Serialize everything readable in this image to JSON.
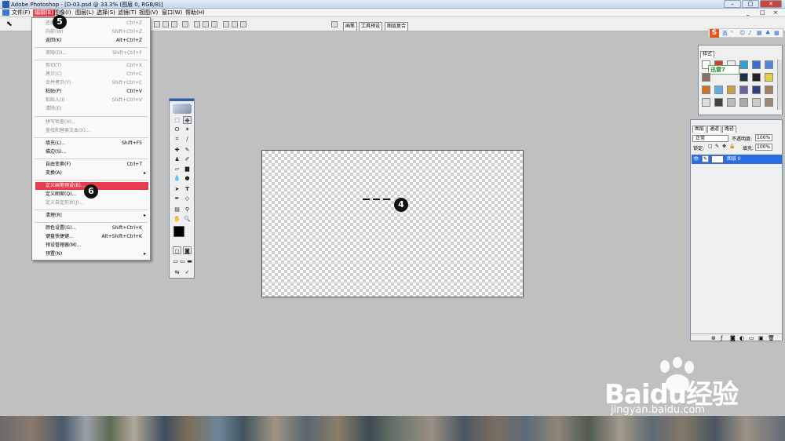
{
  "window": {
    "title": "Adobe Photoshop - [D-03.psd @ 33.3% (图层 0, RGB/8)]"
  },
  "menubar": [
    {
      "label": "文件(F)"
    },
    {
      "label": "编辑(E)",
      "active": true
    },
    {
      "label": "图像(I)"
    },
    {
      "label": "图层(L)"
    },
    {
      "label": "选择(S)"
    },
    {
      "label": "滤镜(T)"
    },
    {
      "label": "视图(V)"
    },
    {
      "label": "窗口(W)"
    },
    {
      "label": "帮助(H)"
    }
  ],
  "palette_well_tabs": [
    "画笔",
    "工具预设",
    "图层复合"
  ],
  "edit_menu": [
    {
      "label": "还原(O)",
      "shortcut": "Ctrl+Z",
      "disabled": true
    },
    {
      "label": "向前(W)",
      "shortcut": "Shift+Ctrl+Z",
      "disabled": true
    },
    {
      "label": "返回(K)",
      "shortcut": "Alt+Ctrl+Z"
    },
    {
      "label": "渐隐(D)...",
      "shortcut": "Shift+Ctrl+F",
      "disabled": true
    },
    {
      "label": "剪切(T)",
      "shortcut": "Ctrl+X",
      "disabled": true
    },
    {
      "label": "拷贝(C)",
      "shortcut": "Ctrl+C",
      "disabled": true
    },
    {
      "label": "合并拷贝(Y)",
      "shortcut": "Shift+Ctrl+C",
      "disabled": true
    },
    {
      "label": "粘贴(P)",
      "shortcut": "Ctrl+V"
    },
    {
      "label": "粘贴入(I)",
      "shortcut": "Shift+Ctrl+V",
      "disabled": true
    },
    {
      "label": "清除(E)",
      "disabled": true
    },
    {
      "label": "拼写检查(H)...",
      "disabled": true
    },
    {
      "label": "查找和替换文本(X)...",
      "disabled": true
    },
    {
      "label": "填充(L)...",
      "shortcut": "Shift+F5"
    },
    {
      "label": "描边(S)..."
    },
    {
      "label": "自由变换(F)",
      "shortcut": "Ctrl+T"
    },
    {
      "label": "变换(A)",
      "submenu": true
    },
    {
      "label": "定义画笔预设(B)...",
      "highlighted": true
    },
    {
      "label": "定义图案(Q)..."
    },
    {
      "label": "定义自定形状(J)...",
      "disabled": true
    },
    {
      "label": "清理(R)",
      "submenu": true
    },
    {
      "label": "颜色设置(G)...",
      "shortcut": "Shift+Ctrl+K"
    },
    {
      "label": "键盘快捷键...",
      "shortcut": "Alt+Shift+Ctrl+K"
    },
    {
      "label": "预设管理器(M)..."
    },
    {
      "label": "预置(N)",
      "submenu": true
    }
  ],
  "styles_panel": {
    "tab": "样式",
    "overlay_text": "迅雷7"
  },
  "layers_panel": {
    "tabs": [
      "图层",
      "通道",
      "路径"
    ],
    "blend_mode": "正常",
    "opacity_label": "不透明度:",
    "opacity_value": "100%",
    "lock_label": "锁定:",
    "fill_label": "填充:",
    "fill_value": "100%",
    "layer_name": "图层 0"
  },
  "annotations": [
    "5",
    "6",
    "4"
  ],
  "ime_toolbar": {
    "logo": "S",
    "mode": "英"
  },
  "watermark": {
    "main": "Baidu经验",
    "sub": "jingyan.baidu.com"
  }
}
